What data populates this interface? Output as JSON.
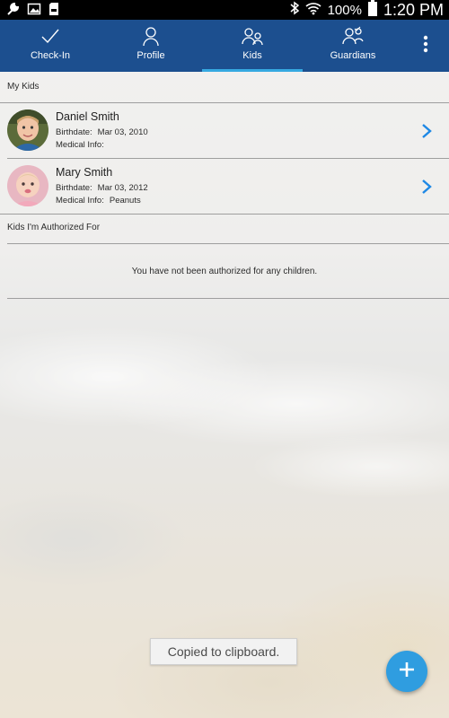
{
  "status_bar": {
    "battery_percent": "100%",
    "time": "1:20 PM",
    "left_icons": [
      "wrench-icon",
      "image-icon",
      "sd-card-icon"
    ],
    "right_icons": [
      "bluetooth-icon",
      "wifi-icon",
      "battery-icon"
    ]
  },
  "tabs": [
    {
      "label": "Check-In",
      "icon": "check-icon",
      "active": false
    },
    {
      "label": "Profile",
      "icon": "person-icon",
      "active": false
    },
    {
      "label": "Kids",
      "icon": "kids-icon",
      "active": true
    },
    {
      "label": "Guardians",
      "icon": "guardians-icon",
      "active": false
    }
  ],
  "menu": {
    "icon": "more-vertical-icon"
  },
  "my_kids": {
    "header": "My Kids",
    "kids": [
      {
        "name": "Daniel Smith",
        "birthdate_label": "Birthdate:",
        "birthdate": "Mar 03, 2010",
        "medical_label": "Medical Info:",
        "medical": ""
      },
      {
        "name": "Mary Smith",
        "birthdate_label": "Birthdate:",
        "birthdate": "Mar 03, 2012",
        "medical_label": "Medical Info:",
        "medical": "Peanuts"
      }
    ]
  },
  "authorized": {
    "header": "Kids I'm Authorized For",
    "empty_message": "You have not been authorized for any children."
  },
  "toast": {
    "text": "Copied to clipboard."
  },
  "fab": {
    "icon": "plus-icon"
  },
  "colors": {
    "app_bar": "#1c4f8f",
    "active_tab_underline": "#36a9e1",
    "chevron": "#1e88e5",
    "fab": "#2f9de0"
  }
}
